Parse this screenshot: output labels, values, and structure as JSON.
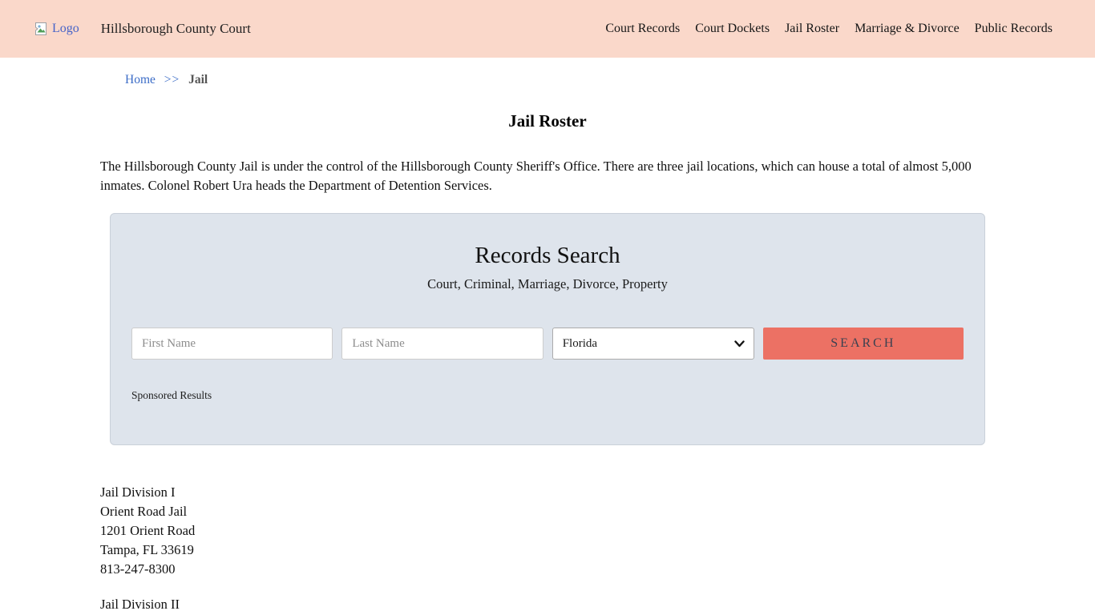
{
  "header": {
    "logo_alt": "Logo",
    "site_title": "Hillsborough County Court",
    "nav": [
      {
        "label": "Court Records"
      },
      {
        "label": "Court Dockets"
      },
      {
        "label": "Jail Roster"
      },
      {
        "label": "Marriage & Divorce"
      },
      {
        "label": "Public Records"
      }
    ]
  },
  "breadcrumb": {
    "home": "Home",
    "separator": ">>",
    "current": "Jail"
  },
  "page": {
    "title": "Jail Roster",
    "intro": "The Hillsborough County Jail is under the control of the Hillsborough County Sheriff's Office. There are three jail locations, which can house a total of almost 5,000 inmates. Colonel Robert Ura heads the Department of Detention Services."
  },
  "search": {
    "title": "Records Search",
    "subtitle": "Court, Criminal, Marriage, Divorce, Property",
    "first_name_placeholder": "First Name",
    "last_name_placeholder": "Last Name",
    "state_selected": "Florida",
    "search_label": "SEARCH",
    "sponsored_label": "Sponsored Results"
  },
  "locations": [
    {
      "lines": [
        "Jail Division I",
        "Orient Road Jail",
        "1201 Orient Road",
        "Tampa, FL 33619",
        "813-247-8300"
      ]
    },
    {
      "lines": [
        "Jail Division II"
      ]
    }
  ],
  "colors": {
    "header_bg": "#fad8ca",
    "panel_bg": "#dee4ec",
    "button_bg": "#ec7164",
    "link_blue": "#3b6cc7"
  }
}
